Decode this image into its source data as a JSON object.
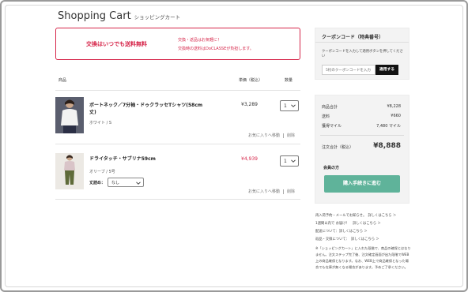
{
  "header": {
    "title": "Shopping Cart",
    "subtitle": "ショッピングカート"
  },
  "banner": {
    "main": "交換はいつでも送料無料",
    "line1": "交換・返品はお気軽に！",
    "line2": "交換時の送料はDoCLASSEが負担します。",
    "accent_color": "#d6264a"
  },
  "table": {
    "headers": {
      "product": "商品",
      "price": "単価（税込）",
      "qty": "数量"
    }
  },
  "items": [
    {
      "name_line1": "ボートネック／7分袖・ドゥクラッセTシャツ(58cm",
      "name_line2": "丈)",
      "variant": "ホワイト / S",
      "price": "¥3,289",
      "qty": "1",
      "favorite": "お気に入りへ移動",
      "delete": "削除"
    },
    {
      "name_line1": "ドライタッチ・サブリナ59cm",
      "variant": "オリーブ / 5号",
      "fit_label": "丈詰め：",
      "fit_value": "なし",
      "price": "¥4,939",
      "qty": "1",
      "favorite": "お気に入りへ移動",
      "delete": "削除"
    }
  ],
  "coupon": {
    "title": "クーポンコード（特典番号）",
    "desc": "クーポンコードを入力して適用ボタンを押してください",
    "placeholder": "5桁のクーポンコードを入力",
    "apply": "適用する"
  },
  "summary": {
    "rows": [
      {
        "label": "商品合計",
        "value": "¥8,228"
      },
      {
        "label": "送料",
        "value": "¥660"
      },
      {
        "label": "獲得マイル",
        "value": "7,480 マイル"
      }
    ],
    "total_label": "注文合計（税込）",
    "total_value": "¥8,888",
    "member_label": "会員の方",
    "checkout": "購入手続きに進む",
    "checkout_color": "#5fb39a"
  },
  "info": [
    "再入荷予約・メールでお知らせ。　詳しくはこちら ＞",
    "1週間以内で お届け！　詳しくはこちら ＞",
    "配送について：詳しくはこちら ＞",
    "返品・交換について：　詳しくはこちら ＞"
  ],
  "note": "※「ショッピングカート」に入れた段階で、商品の確保とはなりません。注文ステップ完了後、注文確定画面が出た段階でWEB上の商品確保となります。なお、WEB上で商品確保となった場合でも在庫が無くなる場合があります。予めご了承ください。"
}
